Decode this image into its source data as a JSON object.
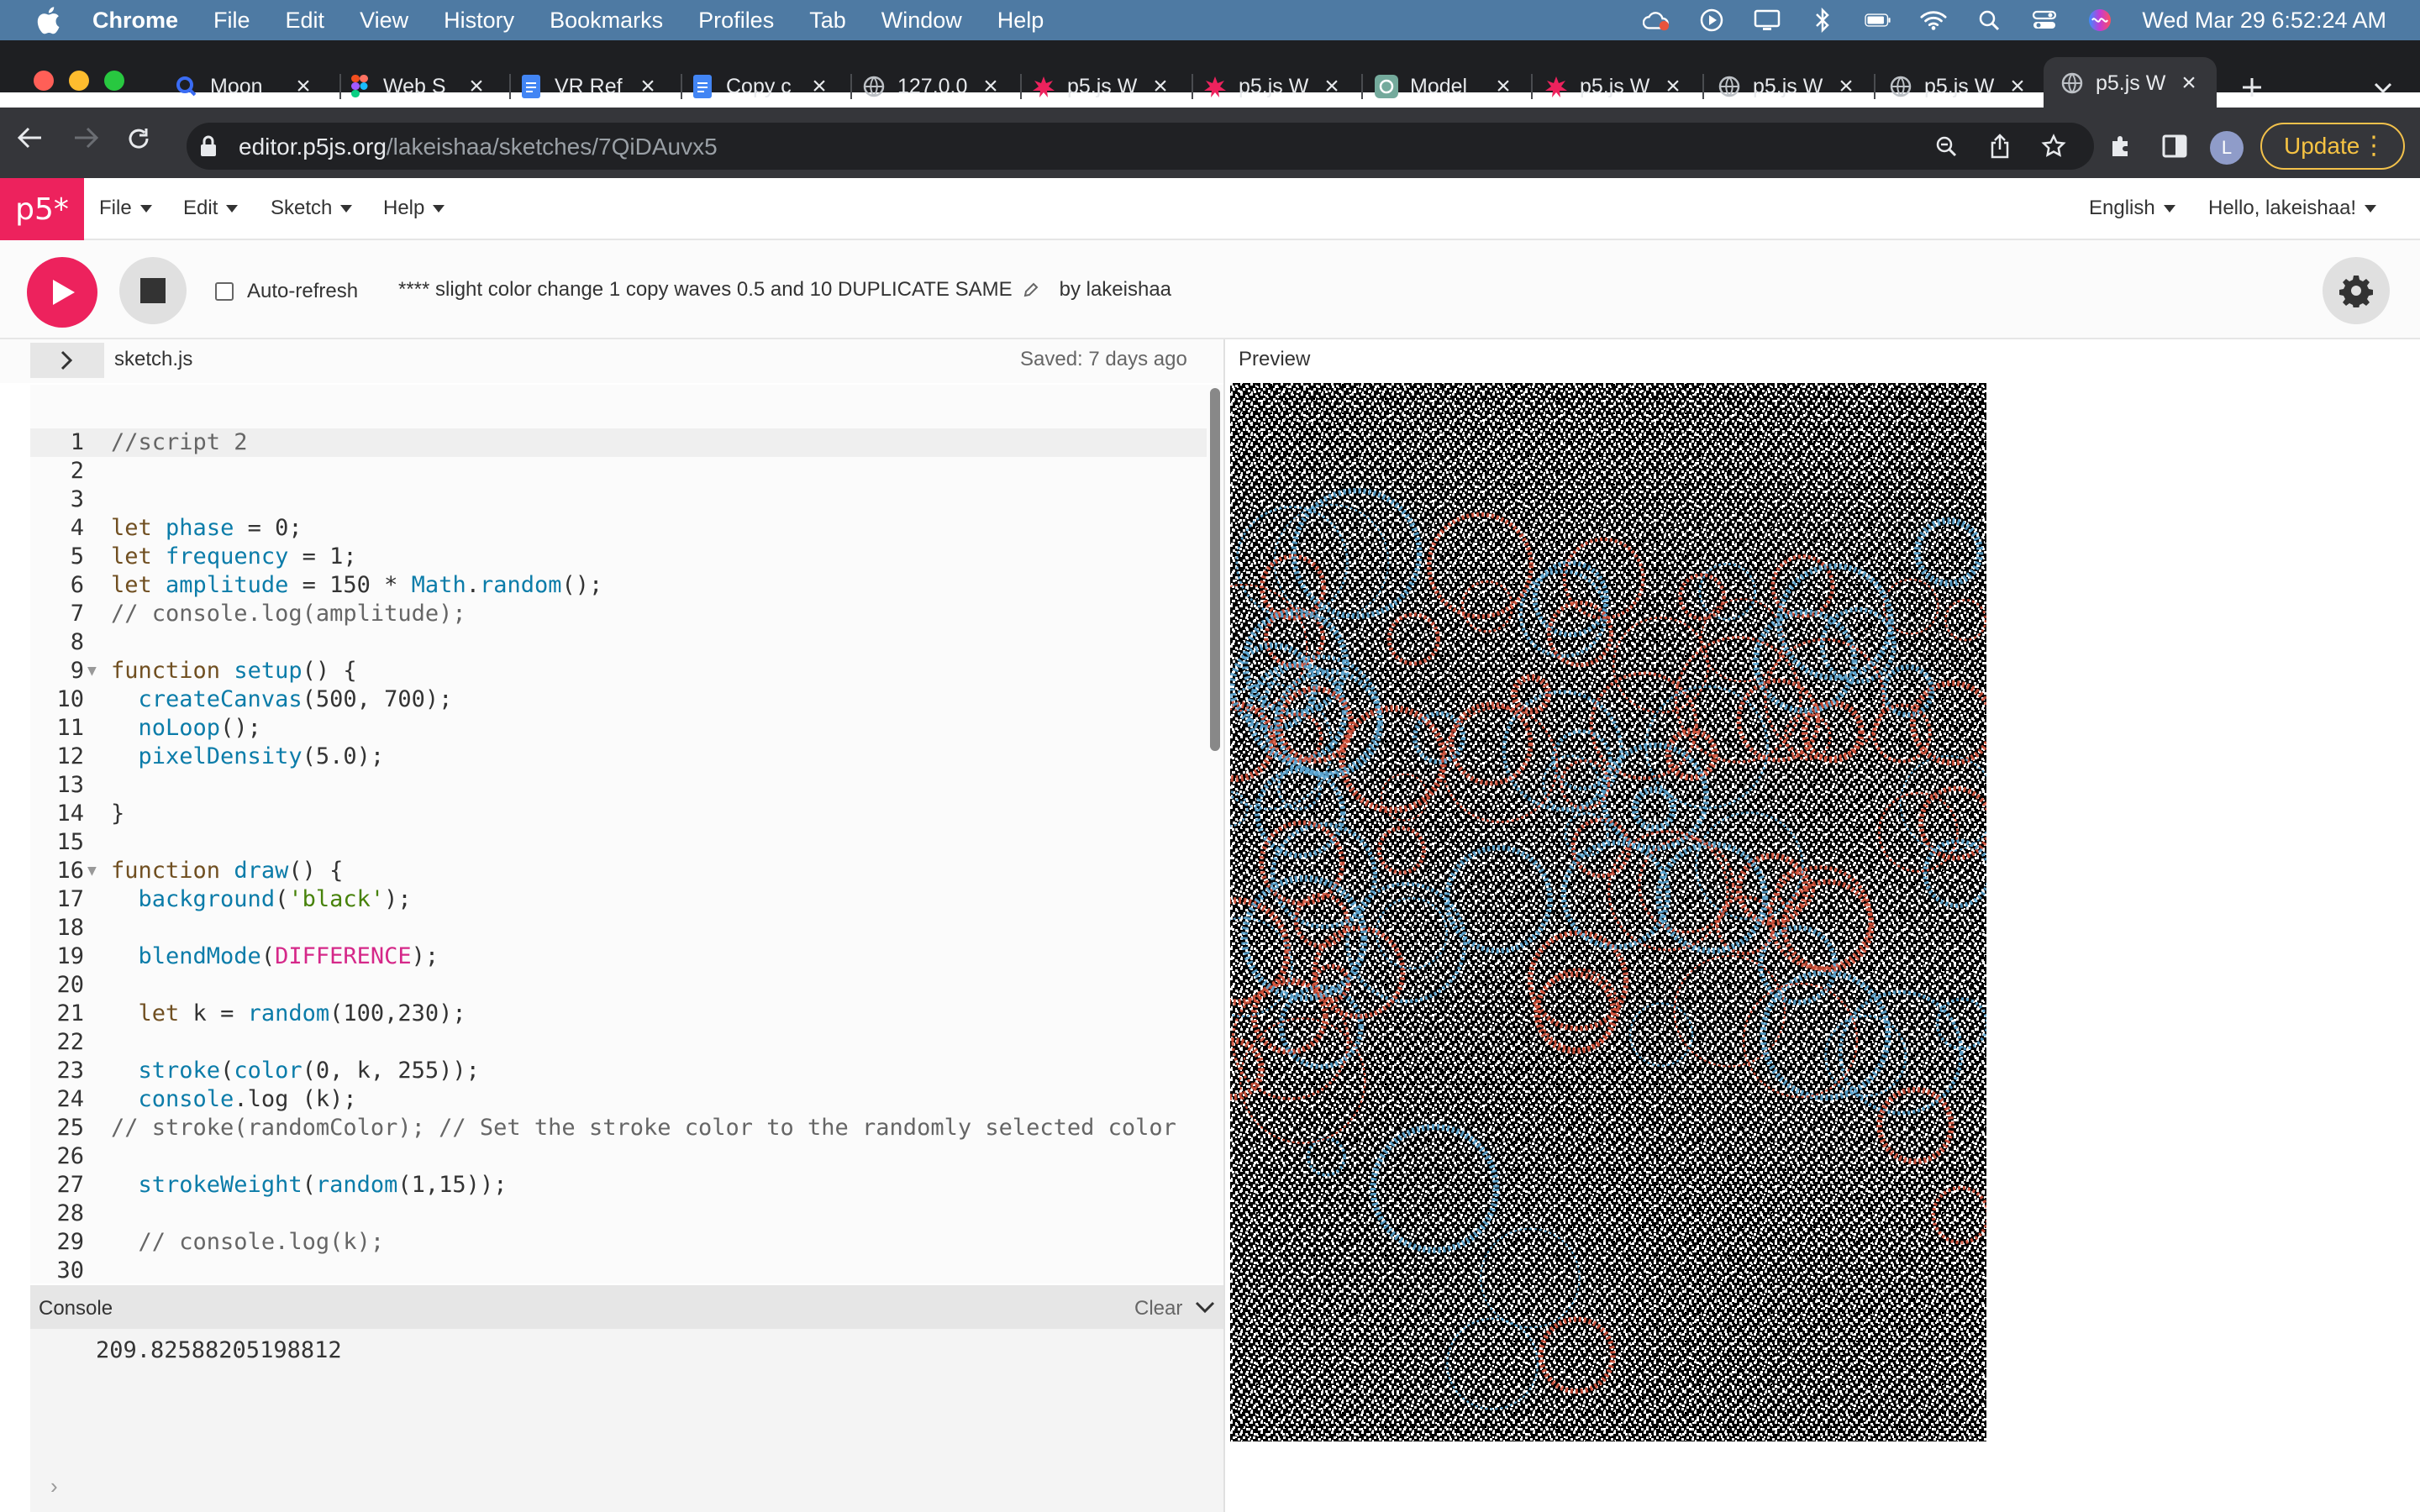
{
  "menubar": {
    "app": "Chrome",
    "items": [
      "File",
      "Edit",
      "View",
      "History",
      "Bookmarks",
      "Profiles",
      "Tab",
      "Window",
      "Help"
    ],
    "clock": "Wed Mar 29  6:52:24 AM"
  },
  "tabs": [
    {
      "label": "Moon",
      "icon": "search-favicon"
    },
    {
      "label": "Web S",
      "icon": "figma-favicon"
    },
    {
      "label": "VR Ref",
      "icon": "docs-favicon"
    },
    {
      "label": "Copy c",
      "icon": "docs-favicon"
    },
    {
      "label": "127.0.0",
      "icon": "globe-favicon"
    },
    {
      "label": "p5.js W",
      "icon": "p5-favicon"
    },
    {
      "label": "p5.js W",
      "icon": "p5-favicon"
    },
    {
      "label": "Model",
      "icon": "openai-favicon"
    },
    {
      "label": "p5.js W",
      "icon": "p5-favicon"
    },
    {
      "label": "p5.js W",
      "icon": "globe-favicon"
    },
    {
      "label": "p5.js W",
      "icon": "globe-favicon"
    },
    {
      "label": "p5.js W",
      "icon": "globe-favicon"
    }
  ],
  "address": {
    "host": "editor.p5js.org",
    "path": "/lakeishaa/sketches/7QiDAuvx5"
  },
  "browser": {
    "update_label": "Update",
    "avatar_initial": "L"
  },
  "p5": {
    "logo": "p5*",
    "menus": [
      "File",
      "Edit",
      "Sketch",
      "Help"
    ],
    "language": "English",
    "greeting": "Hello, lakeishaa!",
    "autorefresh_label": "Auto-refresh",
    "sketch_name": "**** slight color change 1 copy waves 0.5 and 10 DUPLICATE SAME",
    "author": "by lakeishaa",
    "filename": "sketch.js",
    "saved": "Saved: 7 days ago",
    "preview_label": "Preview"
  },
  "code": [
    "//script 2",
    "",
    "",
    "let phase = 0;",
    "let frequency = 1;",
    "let amplitude = 150 * Math.random();",
    "// console.log(amplitude);",
    "",
    "function setup() {",
    "  createCanvas(500, 700);",
    "  noLoop();",
    "  pixelDensity(5.0);",
    "",
    "}",
    "",
    "function draw() {",
    "  background('black');",
    "",
    "  blendMode(DIFFERENCE);",
    "",
    "  let k = random(100,230);",
    "",
    "  stroke(color(0, k, 255));",
    "  console.log (k);",
    "// stroke(randomColor); // Set the stroke color to the randomly selected color",
    "",
    "  strokeWeight(random(1,15));",
    "",
    "  // console.log(k);",
    ""
  ],
  "console": {
    "title": "Console",
    "clear_label": "Clear",
    "output": "209.82588205198812"
  },
  "colors": {
    "p5_pink": "#ed225d",
    "menubar_blue": "#4e7aa3",
    "update_yellow": "#f6c343"
  }
}
